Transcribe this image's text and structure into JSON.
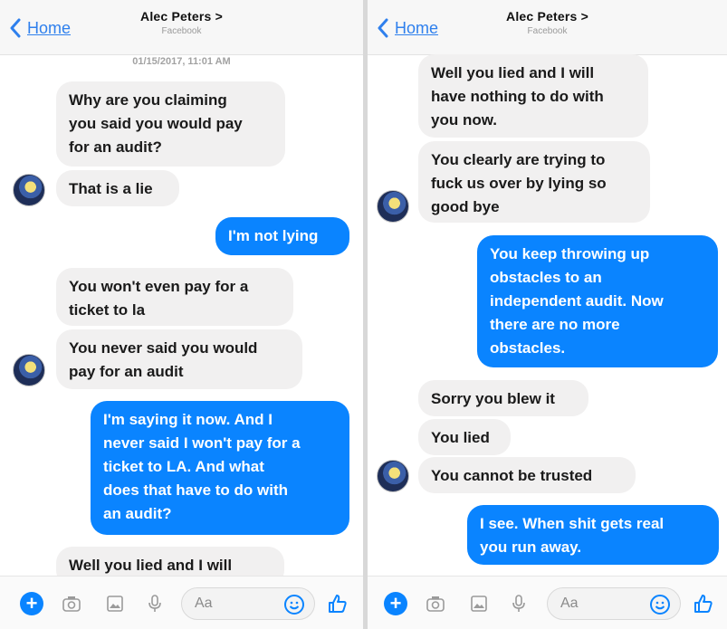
{
  "header": {
    "back_label": "Home",
    "title": "Alec Peters >",
    "subtitle": "Facebook"
  },
  "left_panel": {
    "timestamp": "01/15/2017, 11:01 AM",
    "messages": [
      {
        "text": "Why are you claiming\nyou said you would pay\nfor an audit?"
      },
      {
        "text": "That is a lie"
      },
      {
        "text": "I'm not lying"
      },
      {
        "text": "You won't even pay for a\nticket to la"
      },
      {
        "text": "You never said you would\npay for an audit"
      },
      {
        "text": "I'm saying it now. And I\nnever said I won't pay for a\nticket to LA. And what\ndoes that have to do with\nan audit?"
      },
      {
        "text": "Well you lied and I will"
      }
    ]
  },
  "right_panel": {
    "messages": [
      {
        "text": "Well you lied and I will\nhave nothing to do with\nyou now."
      },
      {
        "text": "You clearly are trying to\nfuck us over by lying so\ngood bye"
      },
      {
        "text": "You keep throwing up\nobstacles to an\nindependent audit. Now\nthere are no more\nobstacles."
      },
      {
        "text": "Sorry you blew it"
      },
      {
        "text": "You lied"
      },
      {
        "text": "You cannot be trusted"
      },
      {
        "text": "I see. When shit gets real\nyou run away."
      }
    ]
  },
  "composer": {
    "placeholder": "Aa",
    "plus": "+"
  },
  "icons": [
    "back-chevron-icon",
    "plus-icon",
    "camera-icon",
    "gallery-icon",
    "microphone-icon",
    "emoji-icon",
    "thumbs-up-icon"
  ],
  "colors": {
    "outgoing_bubble": "#0a84ff",
    "incoming_bubble": "#f1f0f0",
    "link": "#2f80ed"
  }
}
